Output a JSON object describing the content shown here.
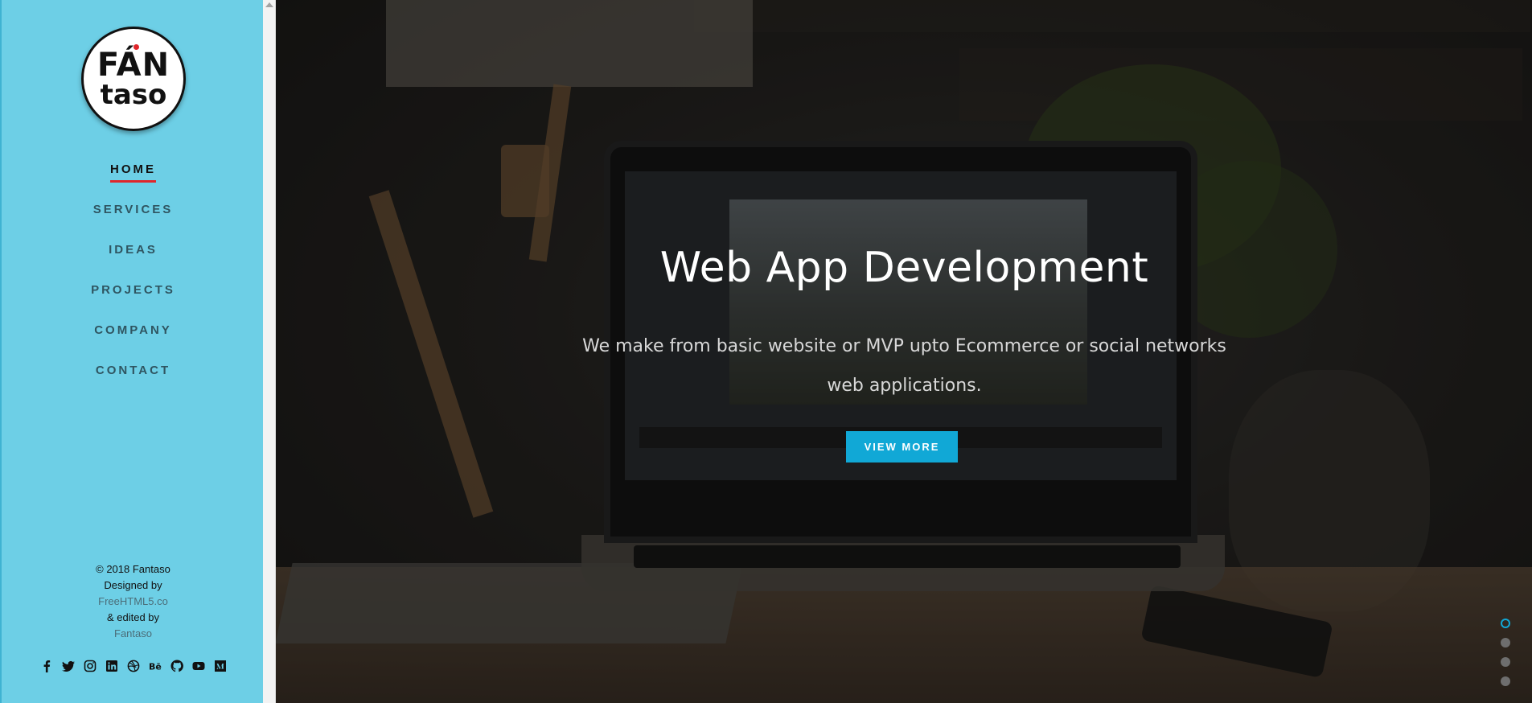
{
  "logo": {
    "line1": "FÁN",
    "line2": "taso"
  },
  "nav": {
    "items": [
      {
        "label": "HOME",
        "active": true
      },
      {
        "label": "SERVICES"
      },
      {
        "label": "IDEAS"
      },
      {
        "label": "PROJECTS"
      },
      {
        "label": "COMPANY"
      },
      {
        "label": "CONTACT"
      }
    ]
  },
  "footer": {
    "copyright": "© 2018 Fantaso",
    "designed_by": "Designed by",
    "designer_link": "FreeHTML5.co",
    "edited_by": "& edited by",
    "editor_link": "Fantaso"
  },
  "social": [
    "facebook-icon",
    "twitter-icon",
    "instagram-icon",
    "linkedin-icon",
    "dribbble-icon",
    "behance-icon",
    "github-icon",
    "youtube-icon",
    "medium-icon"
  ],
  "hero": {
    "title": "Web App Development",
    "subtitle": "We make from basic website or MVP upto Ecommerce or social networks web applications.",
    "cta_label": "VIEW MORE",
    "accent_color": "#11a8d6"
  },
  "slides": {
    "count": 4,
    "active_index": 0
  }
}
